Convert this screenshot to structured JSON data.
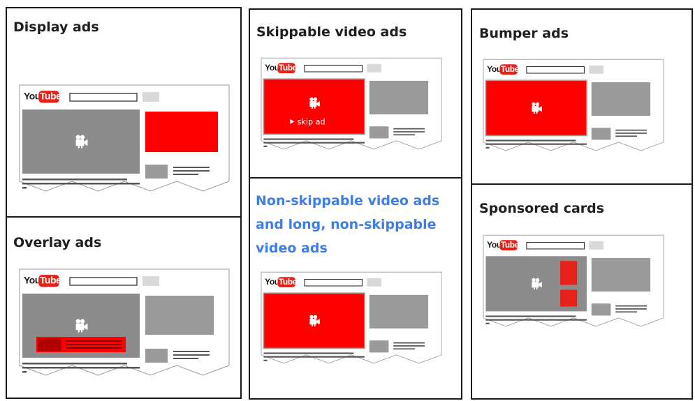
{
  "panels": {
    "display": {
      "title": "Display ads"
    },
    "overlay": {
      "title": "Overlay ads"
    },
    "skippable": {
      "title": "Skippable video ads",
      "skip_label": "skip ad"
    },
    "nonskippable": {
      "title": "Non-skippable video ads and long, non-skippable video ads"
    },
    "bumper": {
      "title": "Bumper ads"
    },
    "sponsored": {
      "title": "Sponsored cards"
    }
  },
  "logo": {
    "you": "You",
    "tube": "Tube"
  },
  "colors": {
    "ad_red": "#ff0000",
    "video_gray": "#8c8c8c",
    "placeholder_gray": "#9a9a9a",
    "title_blue": "#3d7ee8",
    "border": "#1a1a1a"
  },
  "icons": {
    "camera": "movie-camera-icon",
    "play": "play-triangle-icon"
  }
}
